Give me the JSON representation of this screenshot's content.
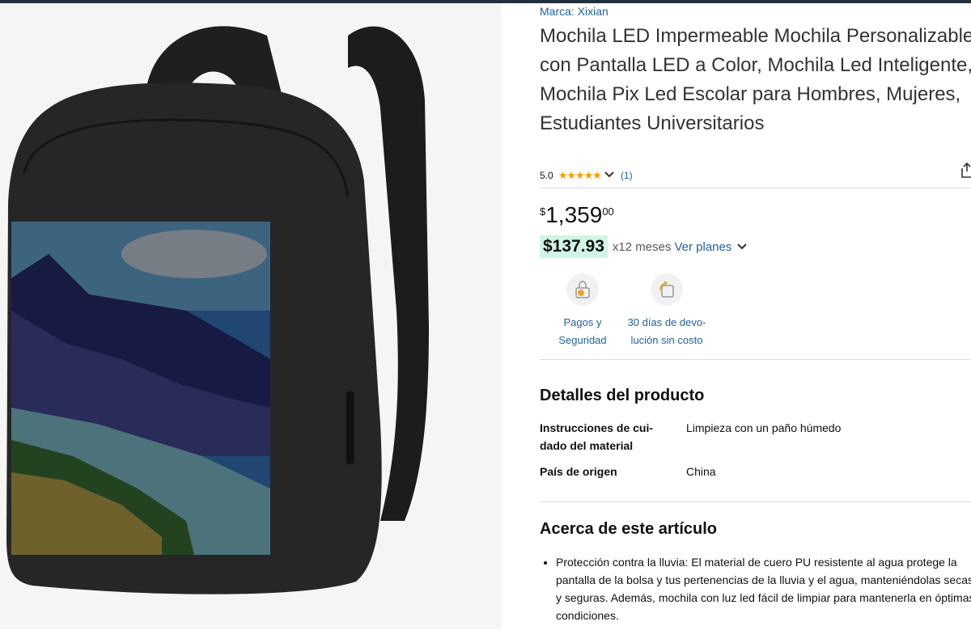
{
  "product": {
    "brand": "Marca: Xixian",
    "title": "Mochila LED Impermeable Mochila Personalizable con Pantalla LED a Color, Mochila Led Inteligente, Mochila Pix Led Escolar para Hombres, Mujeres, Estudiantes Universitarios",
    "rating_value": "5.0",
    "rating_stars": "★★★★★",
    "rating_count": "(1)"
  },
  "price": {
    "symbol": "$",
    "whole": "1,359",
    "fraction": "00"
  },
  "installment": {
    "amount": "$137.93",
    "months": "x12 meses",
    "link": "Ver planes"
  },
  "features": [
    {
      "line1": "Pagos y",
      "line2": "Seguridad",
      "icon": "lock-payment-icon"
    },
    {
      "line1": "30 días de devo-",
      "line2": "lución sin costo",
      "icon": "return-box-icon"
    }
  ],
  "product_details": {
    "title": "Detalles del producto",
    "rows": [
      {
        "label_line1": "Instrucciones de cui-",
        "label_line2": "dado del material",
        "value": "Limpieza con un paño húmedo"
      },
      {
        "label_line1": "País de origen",
        "label_line2": "",
        "value": "China"
      }
    ]
  },
  "about": {
    "title": "Acerca de este artículo",
    "bullets": [
      "Protección contra la lluvia: El material de cuero PU resistente al agua protege la pantalla de la bolsa y tus pertenencias de la lluvia y el agua, manteniéndolas secas y seguras. Además, mochila con luz led fácil de limpiar para mantenerla en óptimas condiciones."
    ]
  },
  "colors": {
    "link": "#2162a1",
    "star": "#ff9900",
    "installment_bg": "#d1f5e4"
  }
}
